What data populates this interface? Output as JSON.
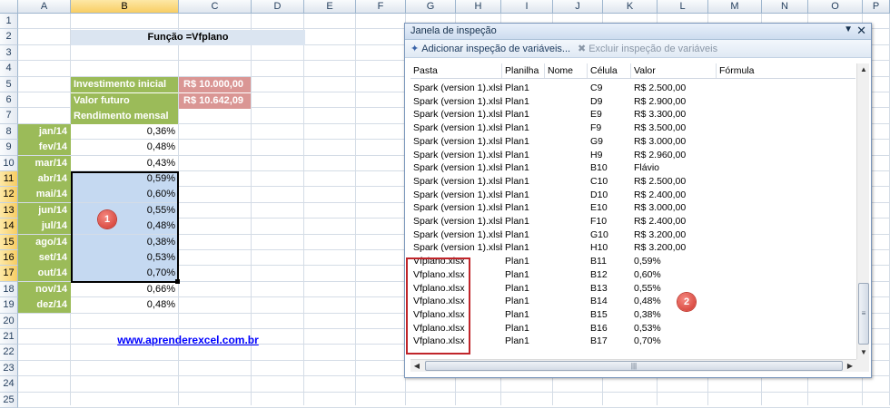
{
  "columns": [
    "A",
    "B",
    "C",
    "D",
    "E",
    "F",
    "G",
    "H",
    "I",
    "J",
    "K",
    "L",
    "M",
    "N",
    "O",
    "P"
  ],
  "selected_column": "B",
  "rows": [
    "1",
    "2",
    "3",
    "4",
    "5",
    "6",
    "7",
    "8",
    "9",
    "10",
    "11",
    "12",
    "13",
    "14",
    "15",
    "16",
    "17",
    "18",
    "19",
    "20",
    "21",
    "22",
    "23",
    "24",
    "25"
  ],
  "selected_rows": [
    "11",
    "12",
    "13",
    "14",
    "15",
    "16",
    "17"
  ],
  "sheet": {
    "title": "Função =Vfplano",
    "labels": {
      "initial_investment": "Investimento inicial",
      "future_value": "Valor futuro",
      "monthly_yield": "Rendimento mensal"
    },
    "values": {
      "initial_investment": "R$  10.000,00",
      "future_value": "R$  10.642,09"
    },
    "months": [
      "jan/14",
      "fev/14",
      "mar/14",
      "abr/14",
      "mai/14",
      "jun/14",
      "jul/14",
      "ago/14",
      "set/14",
      "out/14",
      "nov/14",
      "dez/14"
    ],
    "rates": [
      "0,36%",
      "0,48%",
      "0,43%",
      "0,59%",
      "0,60%",
      "0,55%",
      "0,48%",
      "0,38%",
      "0,53%",
      "0,70%",
      "0,66%",
      "0,48%"
    ],
    "link": "www.aprenderexcel.com.br",
    "badge_1": "1"
  },
  "watch": {
    "title": "Janela de inspeção",
    "add_button": "Adicionar inspeção de variáveis...",
    "delete_button": "Excluir inspeção de variáveis",
    "headers": [
      "Pasta",
      "Planilha",
      "Nome",
      "Célula",
      "Valor",
      "Fórmula"
    ],
    "rows": [
      {
        "book": "Spark (version 1).xlsb",
        "sheet": "Plan1",
        "name": "",
        "cell": "C9",
        "value": "R$ 2.500,00",
        "formula": ""
      },
      {
        "book": "Spark (version 1).xlsb",
        "sheet": "Plan1",
        "name": "",
        "cell": "D9",
        "value": "R$ 2.900,00",
        "formula": ""
      },
      {
        "book": "Spark (version 1).xlsb",
        "sheet": "Plan1",
        "name": "",
        "cell": "E9",
        "value": "R$ 3.300,00",
        "formula": ""
      },
      {
        "book": "Spark (version 1).xlsb",
        "sheet": "Plan1",
        "name": "",
        "cell": "F9",
        "value": "R$ 3.500,00",
        "formula": ""
      },
      {
        "book": "Spark (version 1).xlsb",
        "sheet": "Plan1",
        "name": "",
        "cell": "G9",
        "value": "R$ 3.000,00",
        "formula": ""
      },
      {
        "book": "Spark (version 1).xlsb",
        "sheet": "Plan1",
        "name": "",
        "cell": "H9",
        "value": "R$ 2.960,00",
        "formula": ""
      },
      {
        "book": "Spark (version 1).xlsb",
        "sheet": "Plan1",
        "name": "",
        "cell": "B10",
        "value": "Flávio",
        "formula": ""
      },
      {
        "book": "Spark (version 1).xlsb",
        "sheet": "Plan1",
        "name": "",
        "cell": "C10",
        "value": "R$ 2.500,00",
        "formula": ""
      },
      {
        "book": "Spark (version 1).xlsb",
        "sheet": "Plan1",
        "name": "",
        "cell": "D10",
        "value": "R$ 2.400,00",
        "formula": ""
      },
      {
        "book": "Spark (version 1).xlsb",
        "sheet": "Plan1",
        "name": "",
        "cell": "E10",
        "value": "R$ 3.000,00",
        "formula": ""
      },
      {
        "book": "Spark (version 1).xlsb",
        "sheet": "Plan1",
        "name": "",
        "cell": "F10",
        "value": "R$ 2.400,00",
        "formula": ""
      },
      {
        "book": "Spark (version 1).xlsb",
        "sheet": "Plan1",
        "name": "",
        "cell": "G10",
        "value": "R$ 3.200,00",
        "formula": ""
      },
      {
        "book": "Spark (version 1).xlsb",
        "sheet": "Plan1",
        "name": "",
        "cell": "H10",
        "value": "R$ 3.200,00",
        "formula": ""
      },
      {
        "book": "Vfplano.xlsx",
        "sheet": "Plan1",
        "name": "",
        "cell": "B11",
        "value": "0,59%",
        "formula": ""
      },
      {
        "book": "Vfplano.xlsx",
        "sheet": "Plan1",
        "name": "",
        "cell": "B12",
        "value": "0,60%",
        "formula": ""
      },
      {
        "book": "Vfplano.xlsx",
        "sheet": "Plan1",
        "name": "",
        "cell": "B13",
        "value": "0,55%",
        "formula": ""
      },
      {
        "book": "Vfplano.xlsx",
        "sheet": "Plan1",
        "name": "",
        "cell": "B14",
        "value": "0,48%",
        "formula": ""
      },
      {
        "book": "Vfplano.xlsx",
        "sheet": "Plan1",
        "name": "",
        "cell": "B15",
        "value": "0,38%",
        "formula": ""
      },
      {
        "book": "Vfplano.xlsx",
        "sheet": "Plan1",
        "name": "",
        "cell": "B16",
        "value": "0,53%",
        "formula": ""
      },
      {
        "book": "Vfplano.xlsx",
        "sheet": "Plan1",
        "name": "",
        "cell": "B17",
        "value": "0,70%",
        "formula": ""
      }
    ],
    "badge_2": "2",
    "icons": {
      "add": "add-watch-icon",
      "delete": "delete-watch-icon",
      "dropdown": "dropdown-arrow-icon",
      "close": "close-icon"
    }
  },
  "colors": {
    "green": "#9bbb59",
    "pink": "#da9694",
    "selection": "#c5d9f1",
    "title_band": "#dbe5f1",
    "red_outline": "#c0252a",
    "link": "#0000ff"
  }
}
